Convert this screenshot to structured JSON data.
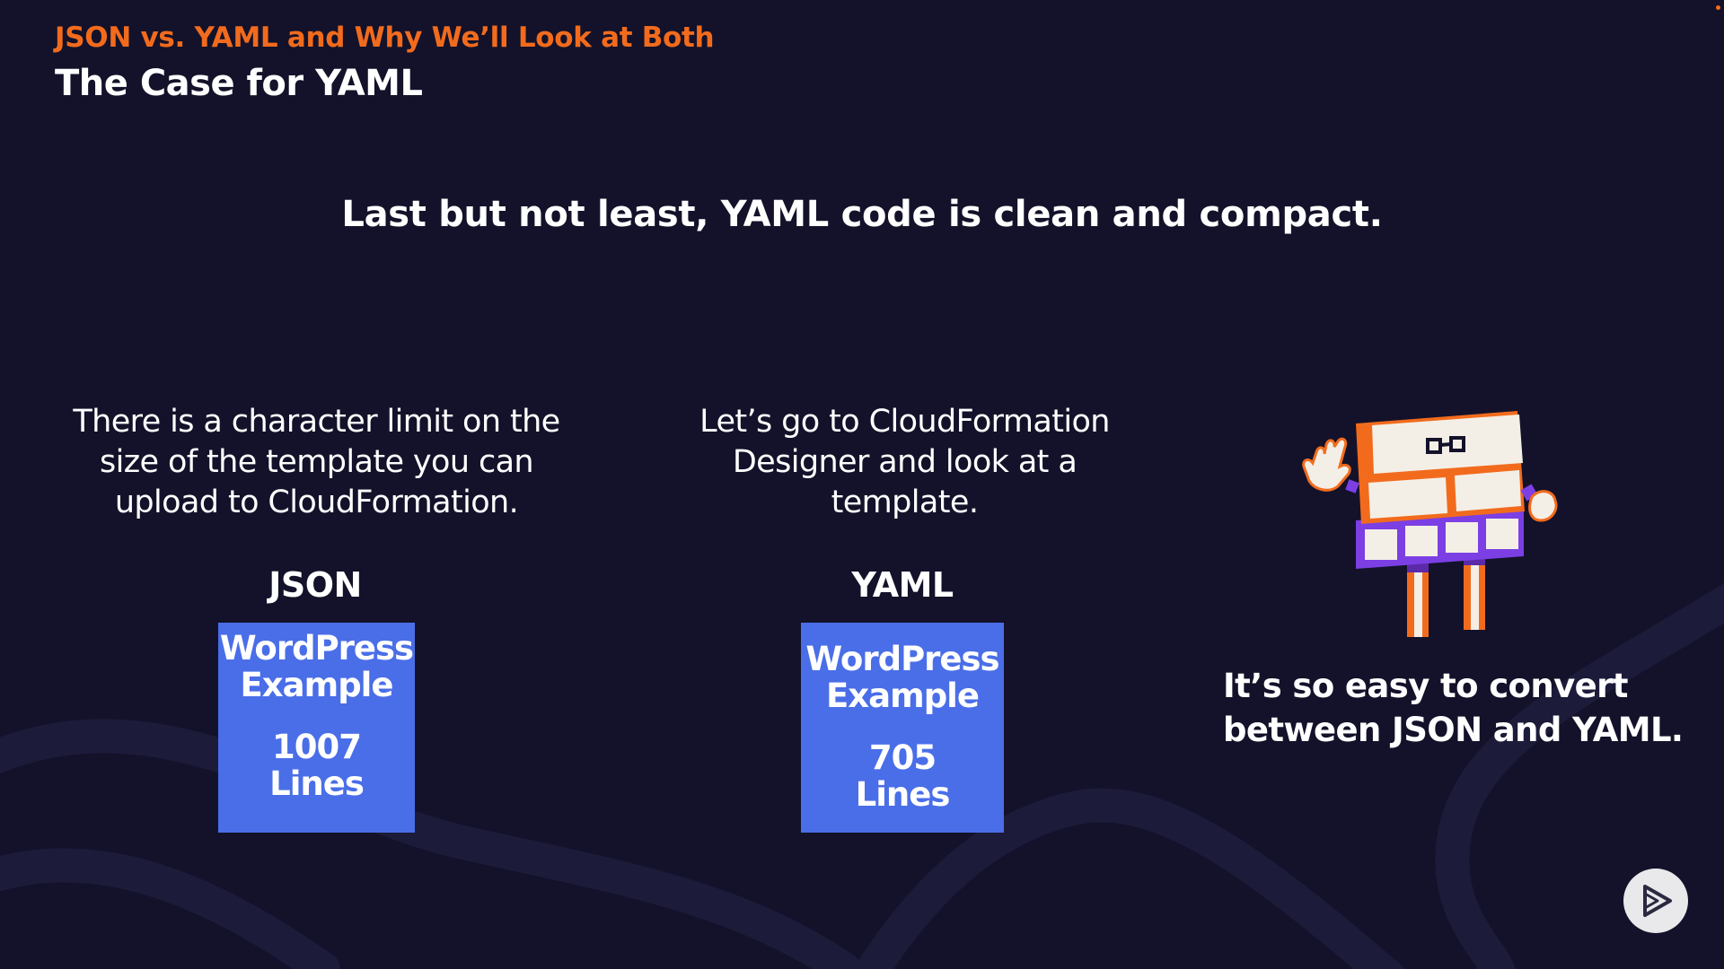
{
  "header": {
    "kicker": "JSON vs. YAML and Why We’ll Look at Both",
    "title": "The Case for YAML"
  },
  "headline": "Last but not least, YAML code is clean and compact.",
  "left_bubble": {
    "lines": [
      "There is a character limit on the",
      "size of the template you can",
      "upload to CloudFormation."
    ]
  },
  "middle_bubble": {
    "lines": [
      "Let’s go to CloudFormation",
      "Designer and look at a",
      "template."
    ]
  },
  "json_column": {
    "label": "JSON",
    "card": {
      "line1": "WordPress",
      "line2": "Example",
      "count": "1007",
      "unit": "Lines"
    }
  },
  "yaml_column": {
    "label": "YAML",
    "card": {
      "line1": "WordPress",
      "line2": "Example",
      "count": "705",
      "unit": "Lines"
    }
  },
  "side_text": {
    "lines": [
      "It’s so easy to convert",
      "between JSON and YAML."
    ]
  },
  "icons": {
    "mascot": "mascot-illustration",
    "play": "play-logo-icon"
  },
  "colors": {
    "background": "#13122a",
    "accent_orange": "#f26b1d",
    "card_blue": "#4a6ee8",
    "mascot_purple": "#7b3fe4"
  }
}
